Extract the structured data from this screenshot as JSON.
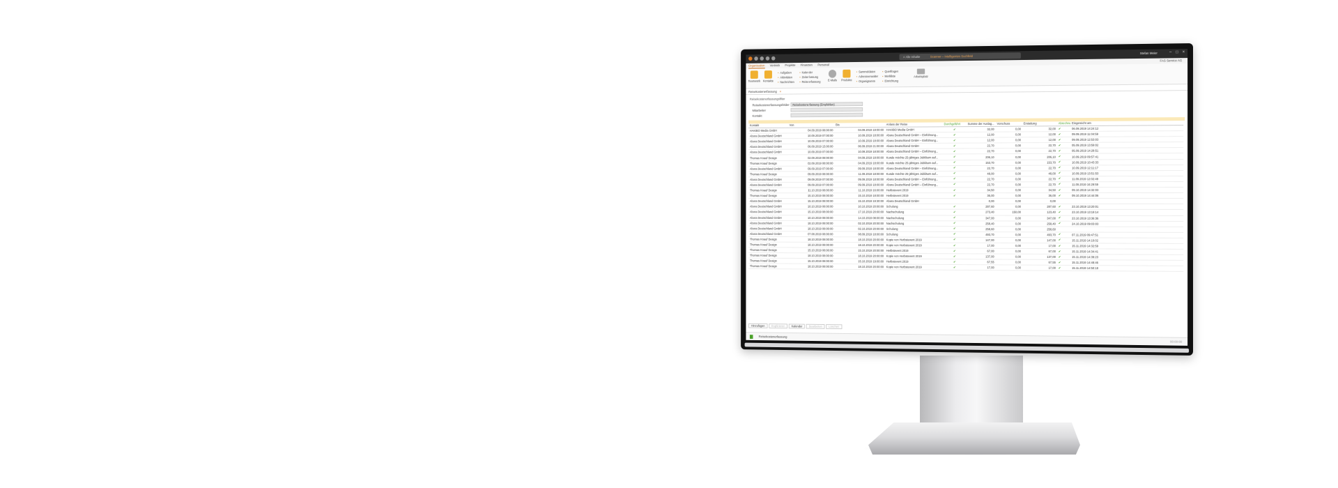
{
  "titlebar": {
    "search_placeholder": "Alle Inhalte",
    "window_title": "Scanner – Intelligentes Suchfeld",
    "user": "Stefan Meier",
    "window_controls": [
      "–",
      "□",
      "×"
    ]
  },
  "ribbon": {
    "tabs": [
      "Organisation",
      "Vertrieb",
      "Projekte",
      "Finanzen",
      "Personal"
    ],
    "active_tab": "Organisation",
    "company": "FAS Service AG",
    "big_buttons": [
      "Teamwork",
      "Kontakte",
      "E-Mails",
      "Produkte"
    ],
    "col1": [
      "Aufgaben",
      "Aktivitäten",
      "Nachrichten"
    ],
    "col2": [
      "Kalender",
      "Zeiterfassung",
      "Reiseerfassung"
    ],
    "col3": [
      "Sammeldaten",
      "Adressverwalter",
      "Organigramm"
    ],
    "col4": [
      "Querfragen",
      "Merkliste",
      "Einrichtung"
    ],
    "workspace": "Arbeitsplatz"
  },
  "document": {
    "tab_label": "Reisekostenerfassung",
    "section": "Reisekostenerfassungsfilter",
    "fields": [
      {
        "label": "Reisekostenerfassungsfelder",
        "value": "Reisekostenerfassung (Empfohlen)"
      },
      {
        "label": "Mitarbeiter",
        "value": ""
      },
      {
        "label": "Kontakt",
        "value": ""
      }
    ]
  },
  "grid": {
    "headers": [
      "Kontakt",
      "Von",
      "Bis",
      "Anlass der Reise",
      "Durchgeführt",
      "Summe der Auslag...",
      "Vorschuss",
      "Erstattung",
      "Abrechnun...",
      "Eingereicht am"
    ],
    "rows": [
      [
        "HAKIBO Media GmbH",
        "04.09.2019 08:00:00",
        "04.09.2019 19:00:00",
        "HAKIBO Media GmbH",
        "✔",
        "32,00",
        "0,00",
        "32,00",
        "✔",
        "06.09.2019 14:24:12"
      ],
      [
        "Abora Deutschland GmbH",
        "10.09.2019 07:00:00",
        "10.09.2019 18:00:00",
        "Abora Deutschland GmbH – Einführung...",
        "✔",
        "12,00",
        "0,00",
        "12,00",
        "✔",
        "09.09.2019 11:04:59"
      ],
      [
        "Abora Deutschland GmbH",
        "10.09.2019 07:00:00",
        "10.09.2019 18:00:00",
        "Abora Deutschland GmbH – Einführung...",
        "✔",
        "12,00",
        "0,00",
        "12,00",
        "✔",
        "09.09.2019 12:53:03"
      ],
      [
        "Abora Deutschland GmbH",
        "06.09.2019 15:00:00",
        "06.09.2019 21:00:00",
        "Abora Deutschland GmbH",
        "✔",
        "22,70",
        "0,00",
        "22,70",
        "✔",
        "05.09.2019 13:59:02"
      ],
      [
        "Abora Deutschland GmbH",
        "10.09.2019 07:00:00",
        "10.09.2019 18:00:00",
        "Abora Deutschland GmbH – Einführung...",
        "✔",
        "22,70",
        "0,00",
        "22,70",
        "✔",
        "05.09.2019 14:28:51"
      ],
      [
        "Thomas Knauf Design",
        "02.09.2019 08:00:00",
        "04.09.2019 18:00:00",
        "Kunde möchte 25-jähriges Jubiläum auf...",
        "✔",
        "206,10",
        "0,00",
        "206,10",
        "✔",
        "10.09.2019 09:57:41"
      ],
      [
        "Thomas Knauf Design",
        "02.09.2019 08:00:00",
        "04.09.2019 18:00:00",
        "Kunde möchte 25-jähriges Jubiläum auf...",
        "✔",
        "153,70",
        "0,00",
        "153,70",
        "✔",
        "10.09.2019 10:43:33"
      ],
      [
        "Abora Deutschland GmbH",
        "09.09.2019 07:00:00",
        "09.09.2019 18:00:00",
        "Abora Deutschland GmbH – Einführung...",
        "✔",
        "22,70",
        "0,00",
        "22,70",
        "✔",
        "10.09.2019 12:11:17"
      ],
      [
        "Thomas Knauf Design",
        "09.09.2019 08:00:00",
        "11.09.2019 18:00:00",
        "Kunde möchte 25-jähriges Jubiläum auf...",
        "✔",
        "48,00",
        "0,00",
        "48,00",
        "✔",
        "10.09.2019 13:51:53"
      ],
      [
        "Abora Deutschland GmbH",
        "09.09.2019 07:00:00",
        "09.09.2019 18:00:00",
        "Abora Deutschland GmbH – Einführung...",
        "✔",
        "22,70",
        "0,00",
        "22,70",
        "✔",
        "11.09.2019 12:02:49"
      ],
      [
        "Abora Deutschland GmbH",
        "09.09.2019 07:00:00",
        "09.09.2019 18:00:00",
        "Abora Deutschland GmbH – Einführung...",
        "✔",
        "22,70",
        "0,00",
        "22,70",
        "✔",
        "11.09.2019 16:29:59"
      ],
      [
        "Thomas Knauf Design",
        "11.10.2019 08:00:00",
        "11.10.2019 16:00:00",
        "Herbstevent 2019",
        "✔",
        "34,50",
        "0,00",
        "34,50",
        "✔",
        "09.10.2019 14:32:03"
      ],
      [
        "Thomas Knauf Design",
        "15.10.2019 08:00:00",
        "15.10.2019 18:00:00",
        "Herbstevent 2019",
        "✔",
        "36,00",
        "0,00",
        "36,00",
        "✔",
        "09.10.2019 14:44:06"
      ],
      [
        "Abora Deutschland GmbH",
        "15.10.2019 08:00:00",
        "15.10.2019 19:30:00",
        "Abora Deutschland GmbH",
        "",
        "0,00",
        "0,00",
        "0,00",
        "",
        ""
      ],
      [
        "Abora Deutschland GmbH",
        "10.10.2019 08:00:00",
        "10.10.2019 20:00:00",
        "Schulung",
        "✔",
        "287,60",
        "0,00",
        "287,60",
        "✔",
        "23.10.2019 13:20:01"
      ],
      [
        "Abora Deutschland GmbH",
        "15.10.2019 08:00:00",
        "17.10.2019 20:00:00",
        "Nachschulung",
        "✔",
        "273,40",
        "150,00",
        "123,40",
        "✔",
        "23.10.2019 13:19:14"
      ],
      [
        "Abora Deutschland GmbH",
        "10.10.2019 08:00:00",
        "14.10.2019 08:00:00",
        "Nachschulung",
        "✔",
        "347,00",
        "0,00",
        "347,00",
        "✔",
        "23.10.2019 13:36:36"
      ],
      [
        "Abora Deutschland GmbH",
        "18.10.2019 08:00:00",
        "02.10.2019 20:00:00",
        "Nachschulung",
        "✔",
        "258,40",
        "0,00",
        "258,40",
        "✔",
        "24.10.2019 09:03:03"
      ],
      [
        "Abora Deutschland GmbH",
        "18.10.2019 08:00:00",
        "02.10.2019 20:00:00",
        "Schulung",
        "✔",
        "258,60",
        "0,00",
        "258,60",
        "",
        ""
      ],
      [
        "Abora Deutschland GmbH",
        "07.08.2019 08:00:00",
        "08.09.2019 18:00:00",
        "Schulung",
        "✔",
        "493,70",
        "0,00",
        "493,70",
        "✔",
        "07.11.2019 09:47:51"
      ],
      [
        "Thomas Knauf Design",
        "18.10.2019 08:00:00",
        "18.10.2019 20:00:00",
        "Kopie von Herbstevent 2019",
        "✔",
        "147,00",
        "0,00",
        "147,00",
        "✔",
        "15.11.2019 14:10:02"
      ],
      [
        "Thomas Knauf Design",
        "18.10.2019 08:00:00",
        "18.10.2019 20:00:00",
        "Kopie von Herbstevent 2019",
        "✔",
        "17,00",
        "0,00",
        "17,00",
        "✔",
        "15.11.2019 14:32:59"
      ],
      [
        "Thomas Knauf Design",
        "15.10.2019 08:00:00",
        "15.10.2019 20:00:00",
        "Herbstevent 2019",
        "✔",
        "67,00",
        "0,00",
        "67,00",
        "✔",
        "15.11.2019 14:34:41"
      ],
      [
        "Thomas Knauf Design",
        "18.10.2019 08:00:00",
        "18.10.2019 20:00:00",
        "Kopie von Herbstevent 2019",
        "✔",
        "137,00",
        "0,00",
        "137,00",
        "✔",
        "15.11.2019 14:39:23"
      ],
      [
        "Thomas Knauf Design",
        "15.10.2019 08:00:00",
        "15.10.2019 19:00:00",
        "Herbstevent 2019",
        "✔",
        "67,55",
        "0,00",
        "67,55",
        "✔",
        "15.11.2019 14:48:46"
      ],
      [
        "Thomas Knauf Design",
        "18.10.2019 08:00:00",
        "18.10.2019 20:00:00",
        "Kopie von Herbstevent 2019",
        "✔",
        "17,00",
        "0,00",
        "17,00",
        "✔",
        "15.11.2019 14:50:18"
      ]
    ]
  },
  "buttons": {
    "add": "Hinzufügen",
    "duplicate": "Duplizieren",
    "calendar": "Kalender",
    "edit": "Bearbeiten",
    "delete": "Löschen"
  },
  "statusbar": {
    "label": "Reisekostenerfassung",
    "right": "00:00:00"
  },
  "colors": {
    "accent": "#c86a12",
    "filter_row": "#fbe9b8",
    "check": "#4aa02a"
  }
}
